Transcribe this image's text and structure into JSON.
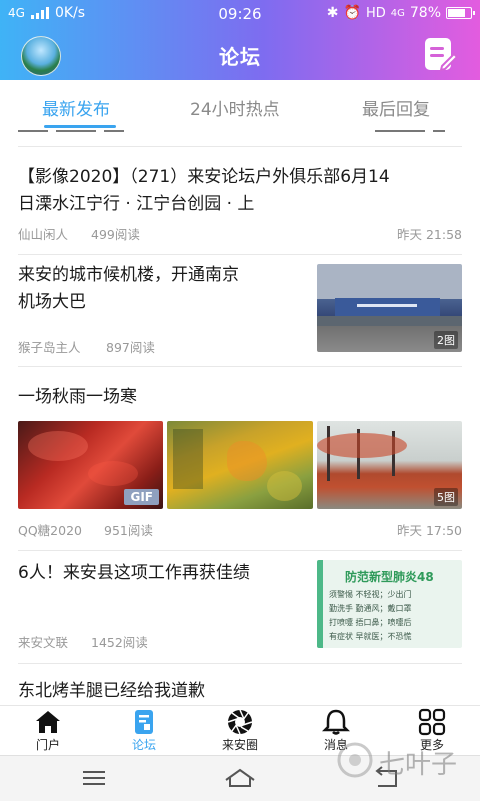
{
  "status_bar": {
    "network": "4G",
    "speed": "0K/s",
    "time": "09:26",
    "hd": "HD",
    "net2": "4G",
    "battery": "78%"
  },
  "header": {
    "title": "论坛"
  },
  "tabs": [
    {
      "label": "最新发布",
      "active": true
    },
    {
      "label": "24小时热点",
      "active": false
    },
    {
      "label": "最后回复",
      "active": false
    }
  ],
  "posts": [
    {
      "title_line1": "【影像2020】（271）来安论坛户外俱乐部6月14",
      "title_line2": "日溧水江宁行 · 江宁台创园 · 上",
      "author": "仙山闲人",
      "reads": "499阅读",
      "time": "昨天 21:58"
    },
    {
      "title_line1": "来安的城市候机楼，开通南京",
      "title_line2": "机场大巴",
      "author": "猴子岛主人",
      "reads": "897阅读",
      "image_badge": "2图"
    },
    {
      "title_line1": "一场秋雨一场寒",
      "author": "QQ糖2020",
      "reads": "951阅读",
      "time": "昨天 17:50",
      "gif_badge": "GIF",
      "image_badge": "5图"
    },
    {
      "title_line1": "6人！来安县这项工作再获佳绩",
      "author": "来安文联",
      "reads": "1452阅读",
      "thumb_heading": "防范新型肺炎48",
      "thumb_lines": [
        "须警惕 不轻视；少出门",
        "勤洗手 勤通风；戴口罩",
        "打喷嚏 捂口鼻；喷嚏后",
        "有症状 早就医；不恐慌"
      ]
    },
    {
      "title_line1": "东北烤羊腿已经给我道歉"
    }
  ],
  "bottom_nav": [
    {
      "label": "门户",
      "icon": "home-icon",
      "active": false
    },
    {
      "label": "论坛",
      "icon": "forum-icon",
      "active": true
    },
    {
      "label": "来安圈",
      "icon": "aperture-icon",
      "active": false
    },
    {
      "label": "消息",
      "icon": "bell-icon",
      "active": false
    },
    {
      "label": "更多",
      "icon": "grid-icon",
      "active": false
    }
  ],
  "watermark": "七叶子",
  "colors": {
    "accent": "#3aa4ef",
    "header_gradient_start": "#3fb3f6",
    "header_gradient_end": "#e35cdf"
  }
}
